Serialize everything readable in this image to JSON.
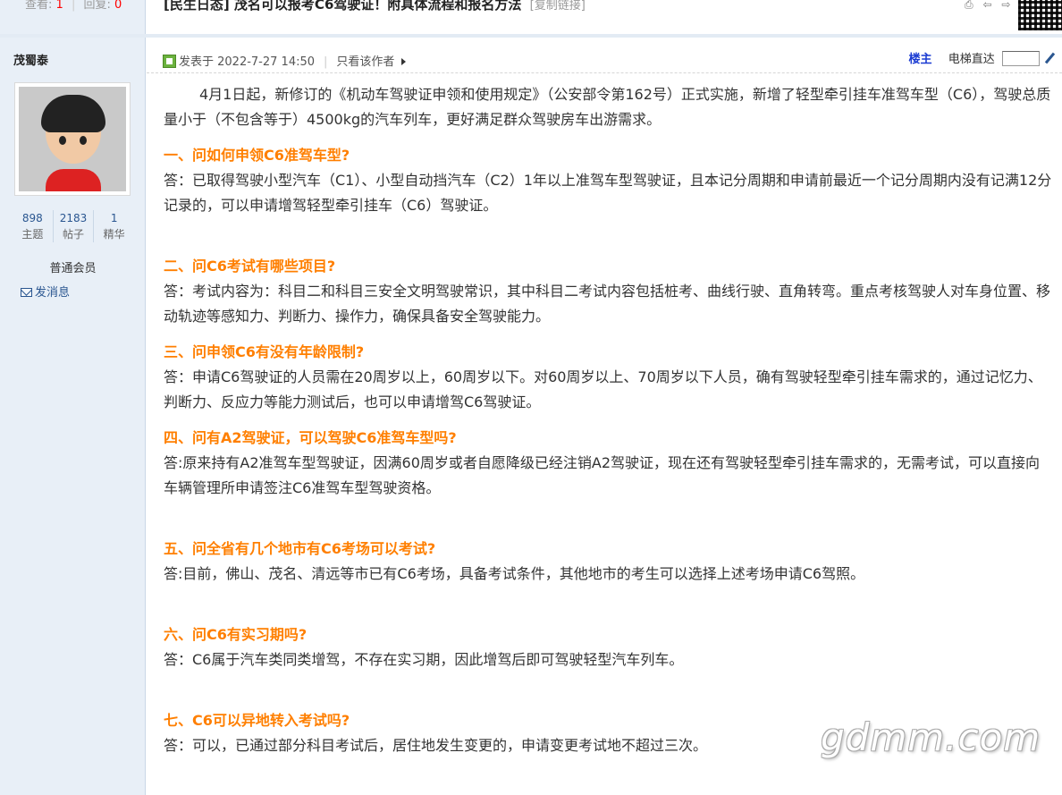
{
  "thread": {
    "views_label": "查看:",
    "views": "1",
    "replies_label": "回复:",
    "replies": "0",
    "title": "[民生日态] 茂名可以报考C6驾驶证！附具体流程和报名方法",
    "copy_link": "[复制链接]"
  },
  "author": {
    "name": "茂蜀泰",
    "stats": [
      {
        "value": "898",
        "label": "主题"
      },
      {
        "value": "2183",
        "label": "帖子"
      },
      {
        "value": "1",
        "label": "精华"
      }
    ],
    "group": "普通会员",
    "send_message": "发消息"
  },
  "post": {
    "posted_label": "发表于 2022-7-27 14:50",
    "only_author": "只看该作者",
    "floor_label": "楼主",
    "jump_label": "电梯直达",
    "jump_value": ""
  },
  "content": {
    "intro": "4月1日起，新修订的《机动车驾驶证申领和使用规定》（公安部令第162号）正式实施，新增了轻型牵引挂车准驾车型（C6），驾驶总质量小于（不包含等于）4500kg的汽车列车，更好满足群众驾驶房车出游需求。",
    "qa": [
      {
        "q": "一、问如何申领C6准驾车型?",
        "a": "答：已取得驾驶小型汽车（C1）、小型自动挡汽车（C2）1年以上准驾车型驾驶证，且本记分周期和申请前最近一个记分周期内没有记满12分记录的，可以申请增驾轻型牵引挂车（C6）驾驶证。"
      },
      {
        "q": "二、问C6考试有哪些项目?",
        "a": "答：考试内容为：科目二和科目三安全文明驾驶常识，其中科目二考试内容包括桩考、曲线行驶、直角转弯。重点考核驾驶人对车身位置、移动轨迹等感知力、判断力、操作力，确保具备安全驾驶能力。"
      },
      {
        "q": "三、问申领C6有没有年龄限制?",
        "a": "答：申请C6驾驶证的人员需在20周岁以上，60周岁以下。对60周岁以上、70周岁以下人员，确有驾驶轻型牵引挂车需求的，通过记忆力、判断力、反应力等能力测试后，也可以申请增驾C6驾驶证。"
      },
      {
        "q": "四、问有A2驾驶证，可以驾驶C6准驾车型吗?",
        "a": "答:原来持有A2准驾车型驾驶证，因满60周岁或者自愿降级已经注销A2驾驶证，现在还有驾驶轻型牵引挂车需求的，无需考试，可以直接向车辆管理所申请签注C6准驾车型驾驶资格。"
      },
      {
        "q": "五、问全省有几个地市有C6考场可以考试?",
        "a": "答:目前，佛山、茂名、清远等市已有C6考场，具备考试条件，其他地市的考生可以选择上述考场申请C6驾照。"
      },
      {
        "q": "六、问C6有实习期吗?",
        "a": "答：C6属于汽车类同类增驾，不存在实习期，因此增驾后即可驾驶轻型汽车列车。"
      },
      {
        "q": "七、C6可以异地转入考试吗?",
        "a": "答：可以，已通过部分科目考试后，居住地发生变更的，申请变更考试地不超过三次。"
      }
    ]
  },
  "watermark": "gdmm.com",
  "icons": {
    "print": "print-icon",
    "prev": "prev-thread-icon",
    "next": "next-thread-icon",
    "qr": "qr-code-icon",
    "mail": "mail-icon",
    "post": "post-status-icon",
    "go": "go-icon"
  }
}
